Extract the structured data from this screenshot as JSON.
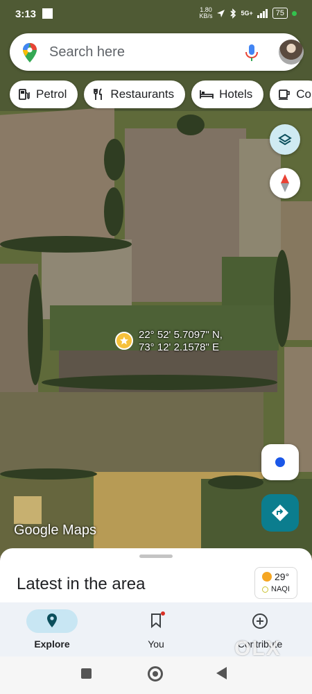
{
  "status_bar": {
    "time": "3:13",
    "net_speed": "1.80",
    "net_unit": "KB/s",
    "signal": "5G+",
    "battery": "75"
  },
  "search": {
    "placeholder": "Search here"
  },
  "chips": [
    {
      "label": "Petrol",
      "icon": "fuel-icon"
    },
    {
      "label": "Restaurants",
      "icon": "fork-knife-icon"
    },
    {
      "label": "Hotels",
      "icon": "bed-icon"
    },
    {
      "label": "Co",
      "icon": "coffee-cup-icon"
    }
  ],
  "map": {
    "coord_lat": "22° 52' 5.7097\" N,",
    "coord_lon": "73° 12' 2.1578\" E",
    "logo": "Google Maps"
  },
  "sheet": {
    "title": "Latest in the area",
    "temperature": "29°",
    "aqi_label": "NAQI"
  },
  "tabs": [
    {
      "label": "Explore",
      "icon": "explore-pin-icon",
      "active": true
    },
    {
      "label": "You",
      "icon": "bookmark-icon",
      "active": false
    },
    {
      "label": "Contribute",
      "icon": "plus-circle-icon",
      "active": false
    }
  ],
  "watermark": "OLX",
  "colors": {
    "accent": "#0b7d8e",
    "active_tab_pill": "#c8e6f3",
    "location_dot": "#1a57e8",
    "marker": "#f6c13b"
  }
}
